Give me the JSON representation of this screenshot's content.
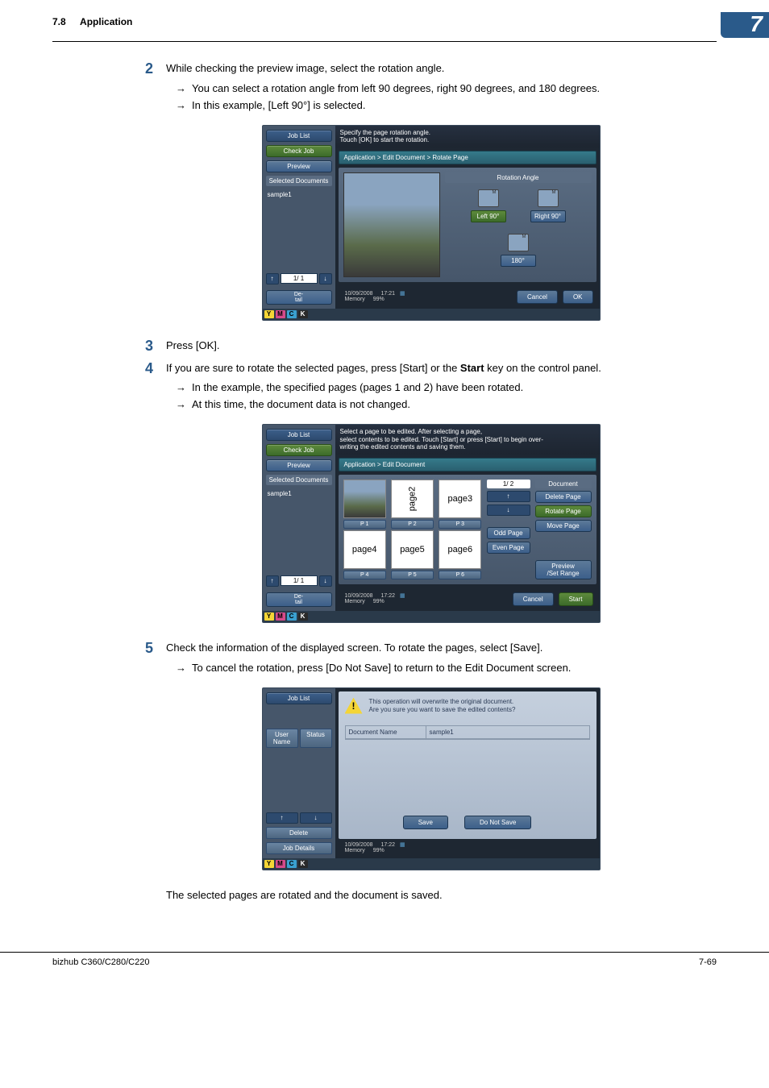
{
  "header": {
    "section_number": "7.8",
    "section_title": "Application",
    "chapter": "7"
  },
  "steps": [
    {
      "num": "2",
      "text": "While checking the preview image, select the rotation angle.",
      "subs": [
        "You can select a rotation angle from left 90 degrees, right 90 degrees, and 180 degrees.",
        "In this example, [Left 90°] is selected."
      ]
    },
    {
      "num": "3",
      "text": "Press [OK].",
      "subs": []
    },
    {
      "num": "4",
      "text": "If you are sure to rotate the selected pages, press [Start] or the Start key on the control panel.",
      "subs": [
        "In the example, the specified pages (pages 1 and 2) have been rotated.",
        "At this time, the document data is not changed."
      ]
    },
    {
      "num": "5",
      "text": "Check the information of the displayed screen. To rotate the pages, select [Save].",
      "subs": [
        "To cancel the rotation, press [Do Not Save] to return to the Edit Document screen."
      ]
    }
  ],
  "step4_bold": "Start",
  "shot1": {
    "sidebar": {
      "job_list": "Job List",
      "check_job": "Check Job",
      "preview": "Preview",
      "sel_docs_hdr": "Selected Documents",
      "doc_name": "sample1",
      "page_info": "1/  1",
      "detail": "De-\ntail"
    },
    "msg": "Specify the page rotation angle.\nTouch [OK] to start the rotation.",
    "breadcrumb": "Application > Edit Document > Rotate Page",
    "rotation_title": "Rotation Angle",
    "rot_left": "Left 90°",
    "rot_right": "Right 90°",
    "rot_180": "180°",
    "cancel": "Cancel",
    "ok": "OK",
    "date": "10/09/2008",
    "time": "17:21",
    "memory_label": "Memory",
    "memory_pct": "99%"
  },
  "shot2": {
    "sidebar": {
      "job_list": "Job List",
      "check_job": "Check Job",
      "preview": "Preview",
      "sel_docs_hdr": "Selected Documents",
      "doc_name": "sample1",
      "page_info": "1/  1",
      "detail": "De-\ntail"
    },
    "msg": "Select a page to be edited. After selecting a page,\nselect contents to be edited. Touch [Start] or press [Start] to begin over-\nwriting the edited contents and saving them.",
    "breadcrumb": "Application > Edit Document",
    "thumbs": [
      "",
      "page2",
      "page3",
      "page4",
      "page5",
      "page6"
    ],
    "p_labels": [
      "P    1",
      "P    2",
      "P    3",
      "P    4",
      "P    5",
      "P    6"
    ],
    "right_page_info": "1/  2",
    "odd_page": "Odd Page",
    "even_page": "Even Page",
    "doc_hdr": "Document",
    "delete_page": "Delete Page",
    "rotate_page": "Rotate Page",
    "move_page": "Move Page",
    "preview_set": "Preview\n/Set Range",
    "cancel": "Cancel",
    "start": "Start",
    "date": "10/09/2008",
    "time": "17:22",
    "memory_label": "Memory",
    "memory_pct": "99%"
  },
  "shot3": {
    "sidebar": {
      "job_list": "Job List",
      "user_name": "User\nName",
      "status": "Status",
      "delete": "Delete",
      "job_details": "Job Details"
    },
    "warn_msg": "This operation will overwrite the original document.\nAre you sure you want to save the edited contents?",
    "doc_name_label": "Document Name",
    "doc_name_value": "sample1",
    "save": "Save",
    "do_not_save": "Do Not Save",
    "date": "10/09/2008",
    "time": "17:22",
    "memory_label": "Memory",
    "memory_pct": "99%"
  },
  "status_strip": {
    "y": "Y",
    "m": "M",
    "c": "C",
    "k": "K"
  },
  "final_note": "The selected pages are rotated and the document is saved.",
  "footer": {
    "model": "bizhub C360/C280/C220",
    "page": "7-69"
  }
}
